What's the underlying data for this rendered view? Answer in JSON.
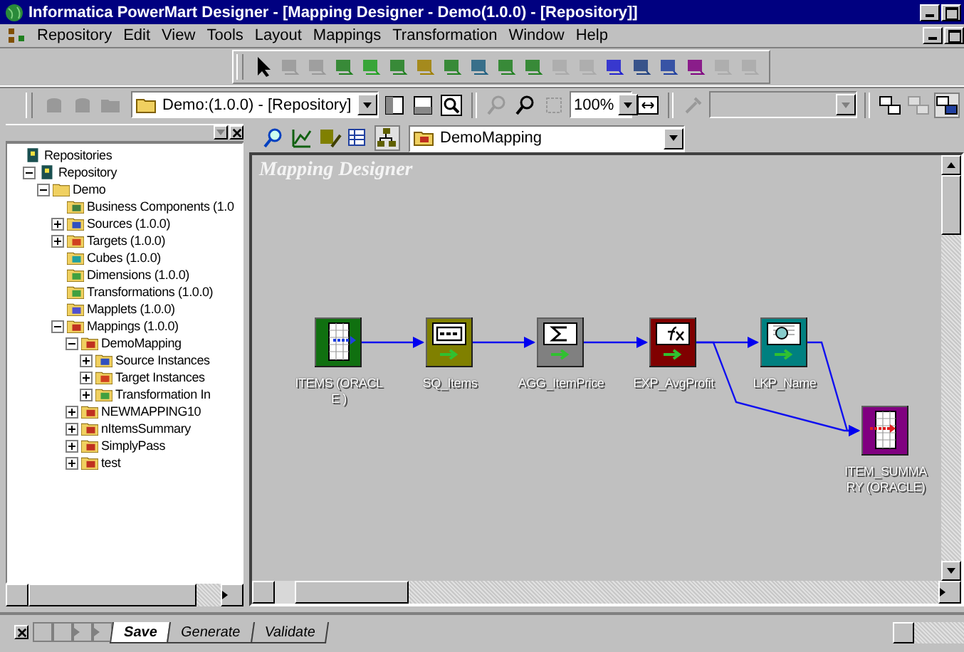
{
  "window": {
    "title": "Informatica PowerMart Designer - [Mapping Designer - Demo(1.0.0) - [Repository]]"
  },
  "menu": [
    "Repository",
    "Edit",
    "View",
    "Tools",
    "Layout",
    "Mappings",
    "Transformation",
    "Window",
    "Help"
  ],
  "toolbar": {
    "repository_combo": "Demo:(1.0.0) - [Repository]",
    "zoom_combo": "100%"
  },
  "tree": [
    {
      "label": "Repositories",
      "kind": "repositories",
      "children": [
        {
          "label": "Repository",
          "kind": "repository",
          "expanded": true,
          "children": [
            {
              "label": "Demo",
              "kind": "folder",
              "expanded": true,
              "children": [
                {
                  "label": "Business Components (1.0",
                  "kind": "business"
                },
                {
                  "label": "Sources (1.0.0)",
                  "kind": "source",
                  "expanded": false
                },
                {
                  "label": "Targets (1.0.0)",
                  "kind": "target",
                  "expanded": false
                },
                {
                  "label": "Cubes (1.0.0)",
                  "kind": "cube"
                },
                {
                  "label": "Dimensions (1.0.0)",
                  "kind": "dimension"
                },
                {
                  "label": "Transformations (1.0.0)",
                  "kind": "transformation"
                },
                {
                  "label": "Mapplets (1.0.0)",
                  "kind": "mapplet"
                },
                {
                  "label": "Mappings (1.0.0)",
                  "kind": "mapping",
                  "expanded": true,
                  "children": [
                    {
                      "label": "DemoMapping",
                      "kind": "mapping",
                      "expanded": true,
                      "children": [
                        {
                          "label": "Source Instances",
                          "kind": "source",
                          "expanded": false
                        },
                        {
                          "label": "Target Instances",
                          "kind": "target",
                          "expanded": false
                        },
                        {
                          "label": "Transformation In",
                          "kind": "transformation",
                          "expanded": false
                        }
                      ]
                    },
                    {
                      "label": "NEWMAPPING10",
                      "kind": "mapping",
                      "expanded": false
                    },
                    {
                      "label": "nItemsSummary",
                      "kind": "mapping",
                      "expanded": false
                    },
                    {
                      "label": "SimplyPass",
                      "kind": "mapping",
                      "expanded": false
                    },
                    {
                      "label": "test",
                      "kind": "mapping",
                      "expanded": false
                    }
                  ]
                }
              ]
            }
          ]
        }
      ]
    }
  ],
  "designer": {
    "mapping_combo": "DemoMapping",
    "heading": "Mapping Designer",
    "nodes": [
      {
        "label": "ITEMS (ORACLE )",
        "kind": "source"
      },
      {
        "label": "SQ_Items",
        "kind": "qualifier"
      },
      {
        "label": "AGG_ItemPrice",
        "kind": "aggregator"
      },
      {
        "label": "EXP_AvgProfit",
        "kind": "expression"
      },
      {
        "label": "LKP_Name",
        "kind": "lookup"
      },
      {
        "label": "ITEM_SUMMARY (ORACLE)",
        "kind": "target"
      }
    ]
  },
  "sheet_tabs": [
    {
      "label": "Save",
      "selected": true
    },
    {
      "label": "Generate",
      "selected": false
    },
    {
      "label": "Validate",
      "selected": false
    }
  ]
}
